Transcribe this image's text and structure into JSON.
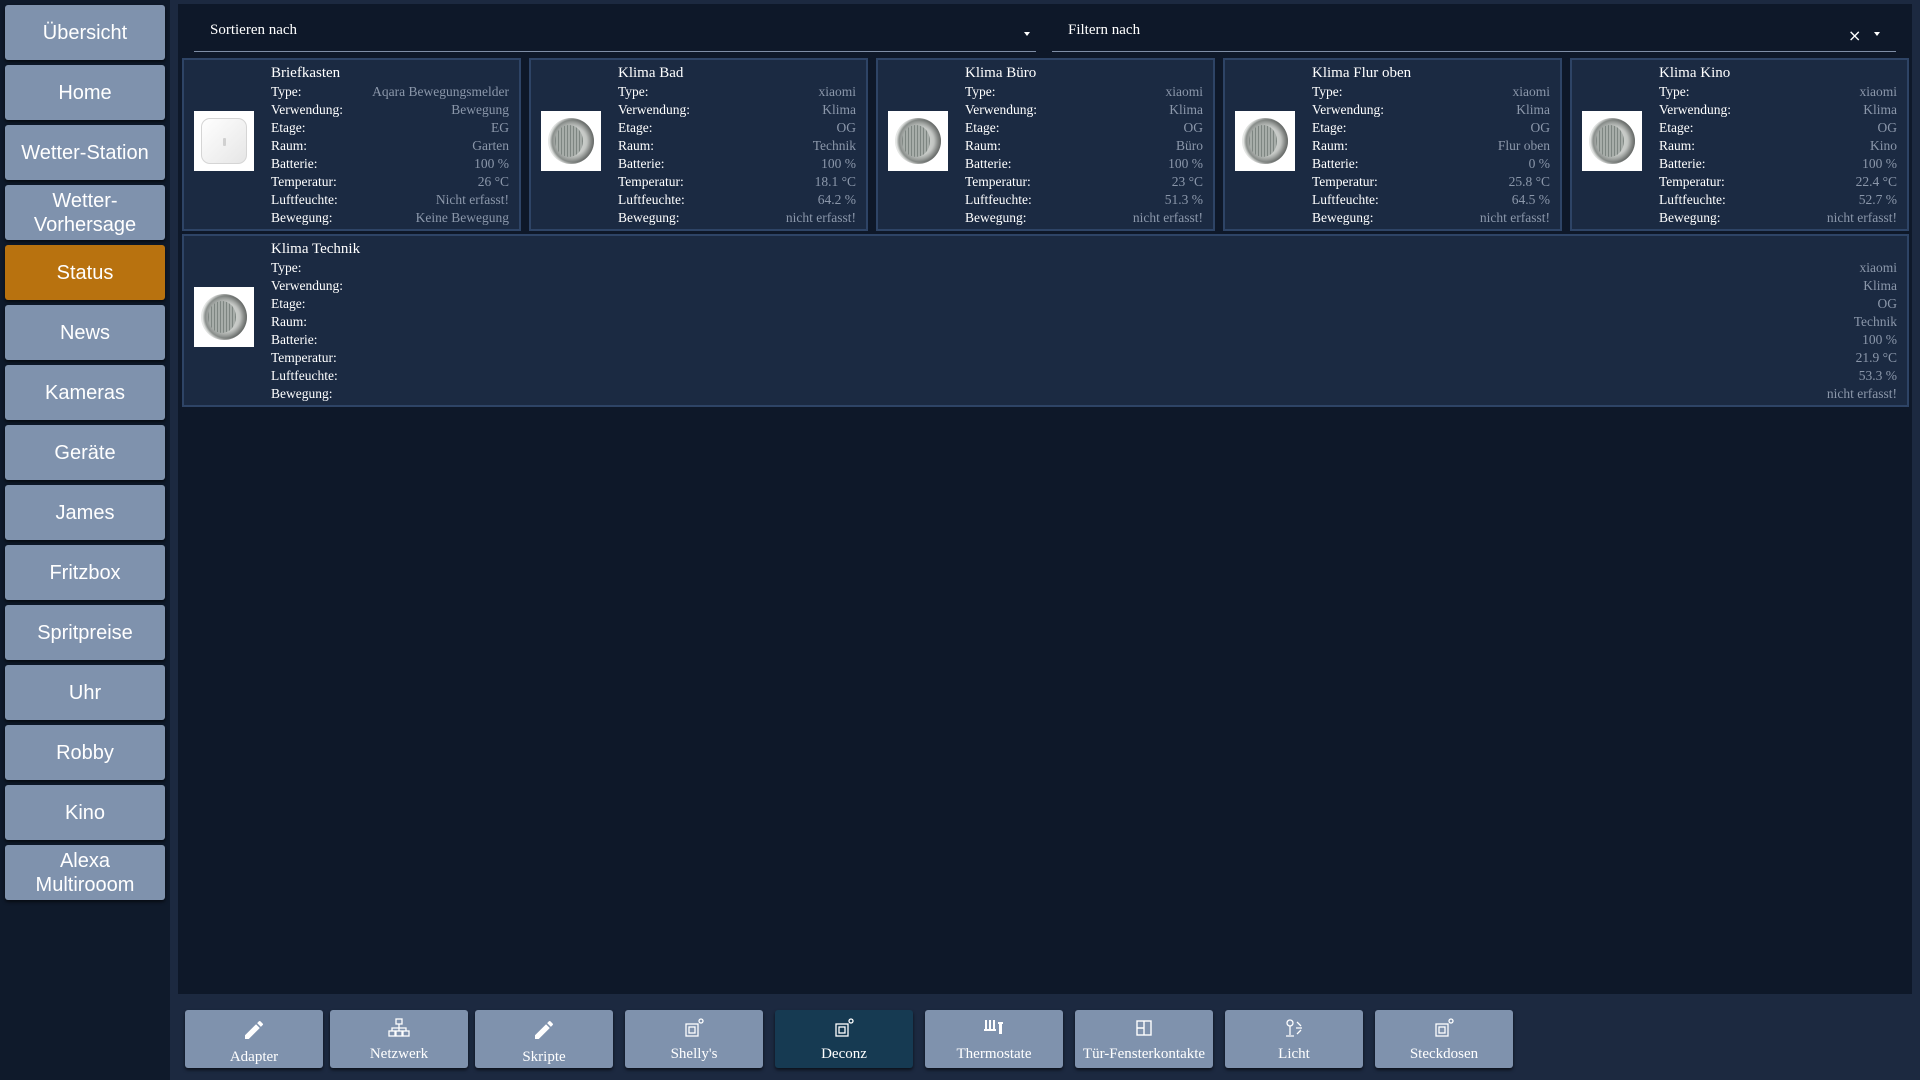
{
  "sidebar": {
    "items": [
      {
        "label": "Übersicht"
      },
      {
        "label": "Home"
      },
      {
        "label": "Wetter-Station"
      },
      {
        "label": "Wetter-\nVorhersage"
      },
      {
        "label": "Status"
      },
      {
        "label": "News"
      },
      {
        "label": "Kameras"
      },
      {
        "label": "Geräte"
      },
      {
        "label": "James"
      },
      {
        "label": "Fritzbox"
      },
      {
        "label": "Spritpreise"
      },
      {
        "label": "Uhr"
      },
      {
        "label": "Robby"
      },
      {
        "label": "Kino"
      },
      {
        "label": "Alexa\nMultirooom"
      }
    ],
    "active": "Status"
  },
  "toolbar": {
    "sort_label": "Sortieren nach",
    "filter_label": "Filtern nach",
    "clear_icon": "×"
  },
  "field_labels": {
    "type": "Type:",
    "usage": "Verwendung:",
    "floor": "Etage:",
    "room": "Raum:",
    "battery": "Batterie:",
    "temperature": "Temperatur:",
    "humidity": "Luftfeuchte:",
    "motion": "Bewegung:"
  },
  "devices": [
    {
      "name": "Briefkasten",
      "icon": "motion-sensor-square-icon",
      "type": "Aqara Bewegungsmelder",
      "usage": "Bewegung",
      "floor": "EG",
      "room": "Garten",
      "battery": "100 %",
      "temperature": "26 °C",
      "humidity": "Nicht erfasst!",
      "motion": "Keine Bewegung"
    },
    {
      "name": "Klima Bad",
      "icon": "climate-sensor-round-icon",
      "type": "xiaomi",
      "usage": "Klima",
      "floor": "OG",
      "room": "Technik",
      "battery": "100 %",
      "temperature": "18.1 °C",
      "humidity": "64.2 %",
      "motion": "nicht erfasst!"
    },
    {
      "name": "Klima Büro",
      "icon": "climate-sensor-round-icon",
      "type": "xiaomi",
      "usage": "Klima",
      "floor": "OG",
      "room": "Büro",
      "battery": "100 %",
      "temperature": "23 °C",
      "humidity": "51.3 %",
      "motion": "nicht erfasst!"
    },
    {
      "name": "Klima Flur oben",
      "icon": "climate-sensor-round-icon",
      "type": "xiaomi",
      "usage": "Klima",
      "floor": "OG",
      "room": "Flur oben",
      "battery": "0 %",
      "temperature": "25.8 °C",
      "humidity": "64.5 %",
      "motion": "nicht erfasst!"
    },
    {
      "name": "Klima Kino",
      "icon": "climate-sensor-round-icon",
      "type": "xiaomi",
      "usage": "Klima",
      "floor": "OG",
      "room": "Kino",
      "battery": "100 %",
      "temperature": "22.4 °C",
      "humidity": "52.7 %",
      "motion": "nicht erfasst!"
    },
    {
      "name": "Klima Technik",
      "icon": "climate-sensor-round-icon",
      "type": "xiaomi",
      "usage": "Klima",
      "floor": "OG",
      "room": "Technik",
      "battery": "100 %",
      "temperature": "21.9 °C",
      "humidity": "53.3 %",
      "motion": "nicht erfasst!"
    }
  ],
  "bottom_nav": [
    {
      "label": "Adapter",
      "icon": "pencil-icon"
    },
    {
      "label": "Netzwerk",
      "icon": "network-icon"
    },
    {
      "label": "Skripte",
      "icon": "pencil-icon"
    },
    {
      "label": "Shelly's",
      "icon": "device-icon"
    },
    {
      "label": "Deconz",
      "icon": "device-icon"
    },
    {
      "label": "Thermostate",
      "icon": "thermostat-icon"
    },
    {
      "label": "Tür-Fensterkontakte",
      "icon": "door-window-icon"
    },
    {
      "label": "Licht",
      "icon": "light-icon"
    },
    {
      "label": "Steckdosen",
      "icon": "device-icon"
    }
  ],
  "bottom_active": "Deconz",
  "colors": {
    "active_sidebar": "#b8720f",
    "button": "#7f92ad",
    "active_bottom": "#163a52",
    "card_bg": "#1b2a42",
    "background": "#0e1829"
  }
}
